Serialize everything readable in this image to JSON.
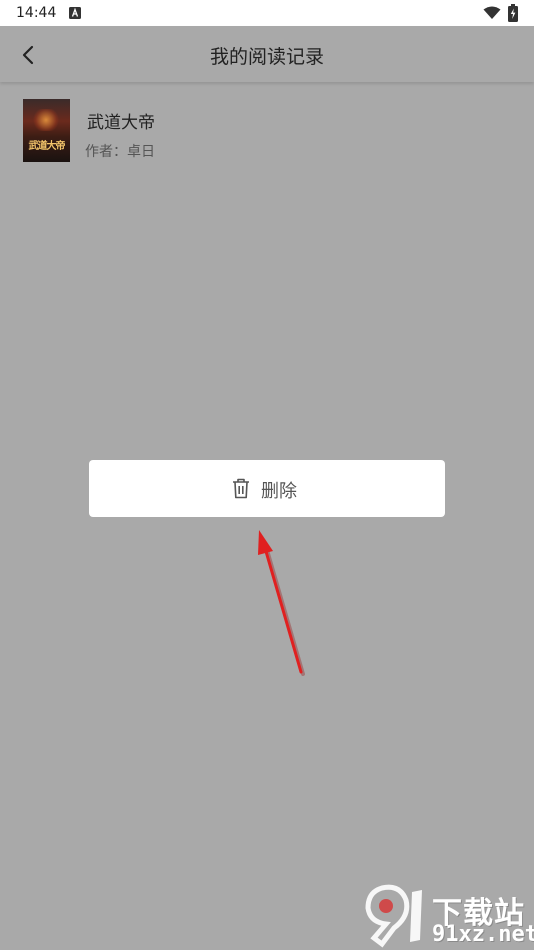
{
  "status_bar": {
    "time": "14:44"
  },
  "app_bar": {
    "title": "我的阅读记录"
  },
  "history": [
    {
      "cover_text": "武道大帝",
      "title": "武道大帝",
      "author_label": "作者：",
      "author": "卓日"
    }
  ],
  "context_menu": {
    "delete_label": "删除"
  },
  "watermark": {
    "top": "下载站",
    "bottom": "91xz.net"
  },
  "colors": {
    "overlay": "#a9a9a9",
    "card": "#ffffff",
    "arrow": "#e02020"
  }
}
